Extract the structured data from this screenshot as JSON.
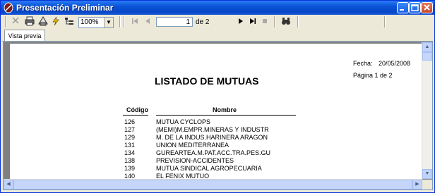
{
  "window": {
    "title": "Presentación Preliminar"
  },
  "toolbar": {
    "zoom_value": "100%",
    "current_page": "1",
    "of_total": "de 2"
  },
  "tabs": [
    {
      "label": "Vista previa"
    }
  ],
  "report": {
    "fecha_label": "Fecha:",
    "fecha_value": "20/05/2008",
    "pagina": "Página 1 de 2",
    "heading": "LISTADO DE MUTUAS",
    "col_codigo": "Código",
    "col_nombre": "Nombre",
    "rows": [
      {
        "codigo": "126",
        "nombre": "MUTUA CYCLOPS"
      },
      {
        "codigo": "127",
        "nombre": "(MEMI)M.EMPR.MINERAS Y INDUSTR"
      },
      {
        "codigo": "129",
        "nombre": "M. DE LA INDUS.HARINERA ARAGON"
      },
      {
        "codigo": "131",
        "nombre": "UNION MEDITERRANEA"
      },
      {
        "codigo": "134",
        "nombre": "GUREARTEA.M.PAT.ACC.TRA.PES.GU"
      },
      {
        "codigo": "138",
        "nombre": "PREVISION-ACCIDENTES"
      },
      {
        "codigo": "139",
        "nombre": "MUTUA SINDICAL AGROPECUARIA"
      },
      {
        "codigo": "140",
        "nombre": "EL FENIX MUTUO"
      }
    ]
  }
}
